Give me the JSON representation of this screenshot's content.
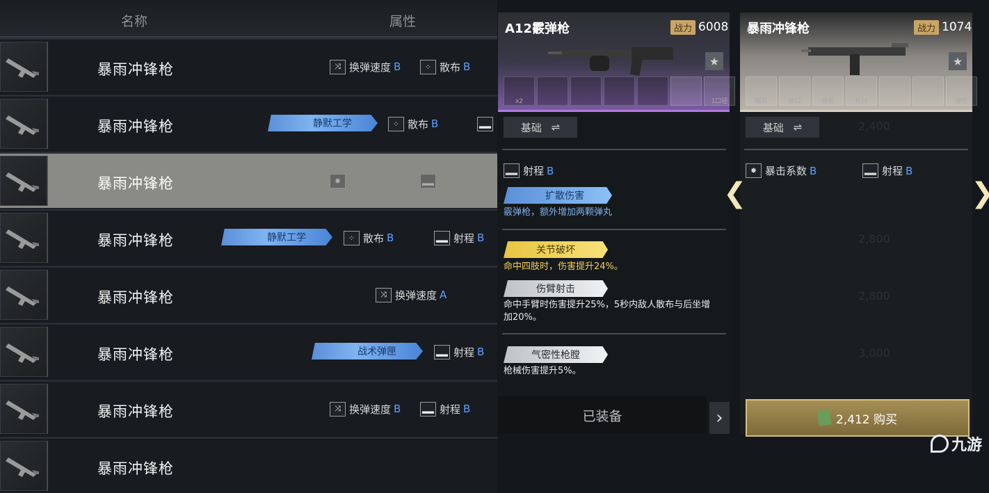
{
  "header": {
    "col_name": "名称",
    "col_attr": "属性"
  },
  "rows": [
    {
      "name": "暴雨冲锋枪"
    },
    {
      "name": "暴雨冲锋枪"
    },
    {
      "name": "暴雨冲锋枪"
    },
    {
      "name": "暴雨冲锋枪"
    },
    {
      "name": "暴雨冲锋枪"
    },
    {
      "name": "暴雨冲锋枪"
    },
    {
      "name": "暴雨冲锋枪"
    },
    {
      "name": "暴雨冲锋枪"
    }
  ],
  "attrs": {
    "reload": "换弹速度",
    "spread": "散布",
    "range": "射程",
    "grade_b": "B",
    "grade_a": "A",
    "perk_silent": "静默工学",
    "perk_tactical": "战术弹匣"
  },
  "left_panel": {
    "name": "A12霰弹枪",
    "power_label": "战力",
    "power": "6008",
    "star": "★",
    "slot_count": "x2",
    "slot_last": "1口径",
    "basic_label": "基础",
    "swap_icon": "⇌",
    "stat": "射程",
    "stat_grade": "B",
    "perk1": "扩散伤害",
    "perk1_desc": "霰弹枪，额外增加两颗弹丸",
    "perk2": "关节破坏",
    "perk2_desc": "命中四肢时，伤害提升24%。",
    "perk3": "伤臂射击",
    "perk3_desc": "命中手臂时伤害提升25%，5秒内敌人散布与后坐增加20%。",
    "perk4": "气密性枪膛",
    "perk4_desc": "枪械伤害提升5%。",
    "equipped": "已装备",
    "next": "›"
  },
  "right_panel": {
    "name": "暴雨冲锋枪",
    "power_label": "战力",
    "power": "1074",
    "star": "★",
    "slot_labels": [
      "瞄具",
      "枪口",
      "握把",
      "枪托",
      "",
      "",
      "弹匣"
    ],
    "basic_label": "基础",
    "swap_icon": "⇌",
    "stat1": "暴击系数",
    "stat1_grade": "B",
    "stat2": "射程",
    "stat2_grade": "B",
    "price": "2,412 购买",
    "bg_prices": [
      "2,400",
      "2,800",
      "2,800",
      "3,000"
    ]
  },
  "nav": {
    "prev": "❮",
    "next": "❯"
  },
  "watermark": "九游"
}
